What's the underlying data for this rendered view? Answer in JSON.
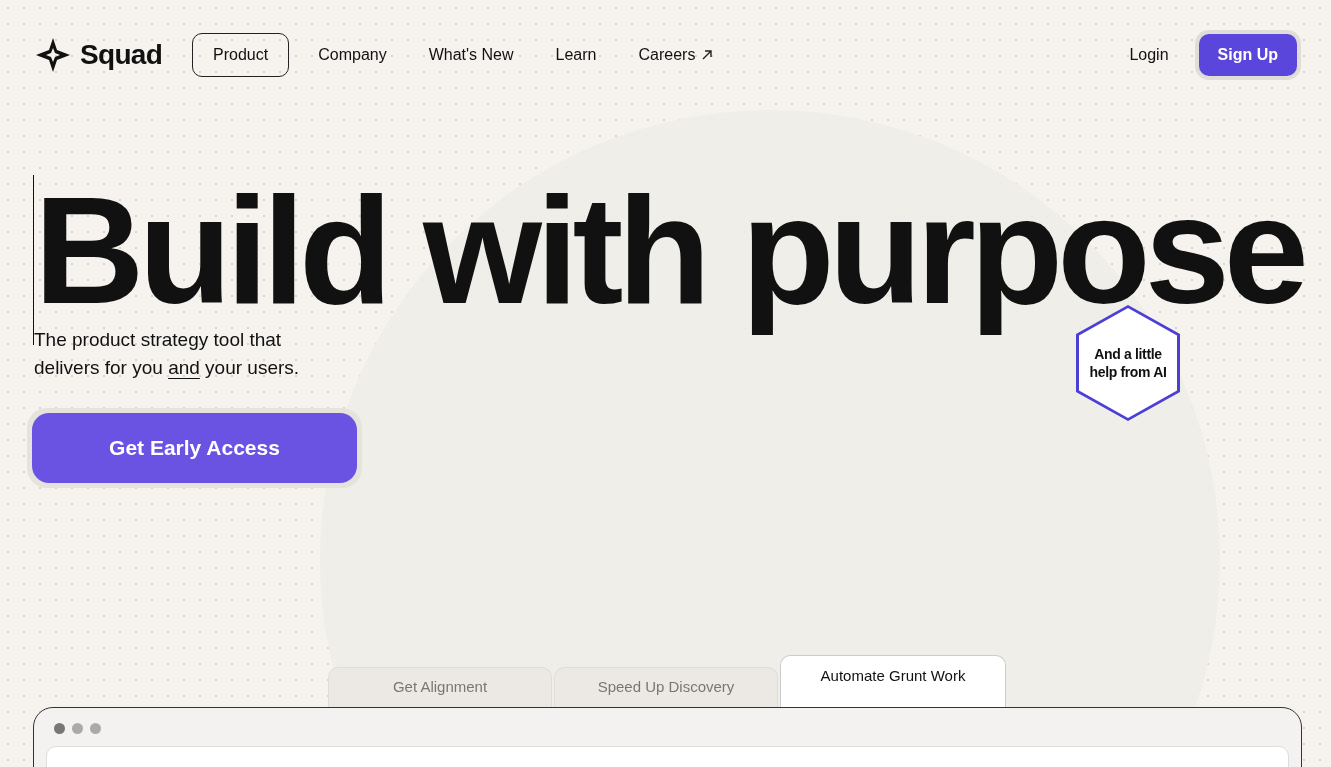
{
  "brand": {
    "name": "Squad"
  },
  "nav": [
    {
      "label": "Product",
      "selected": true,
      "external": false
    },
    {
      "label": "Company",
      "selected": false,
      "external": false
    },
    {
      "label": "What's New",
      "selected": false,
      "external": false
    },
    {
      "label": "Learn",
      "selected": false,
      "external": false
    },
    {
      "label": "Careers",
      "selected": false,
      "external": true
    }
  ],
  "auth": {
    "login": "Login",
    "signup": "Sign Up"
  },
  "hero": {
    "headline": "Build with purpose",
    "subtitle": {
      "before": "The product strategy tool that delivers for you",
      "underlined": "and",
      "after": "your users."
    },
    "badge": "And a little help from AI",
    "cta": "Get Early Access"
  },
  "tabs": [
    {
      "label": "Get Alignment",
      "selected": false
    },
    {
      "label": "Speed Up Discovery",
      "selected": false
    },
    {
      "label": "Automate Grunt Work",
      "selected": true
    }
  ]
}
